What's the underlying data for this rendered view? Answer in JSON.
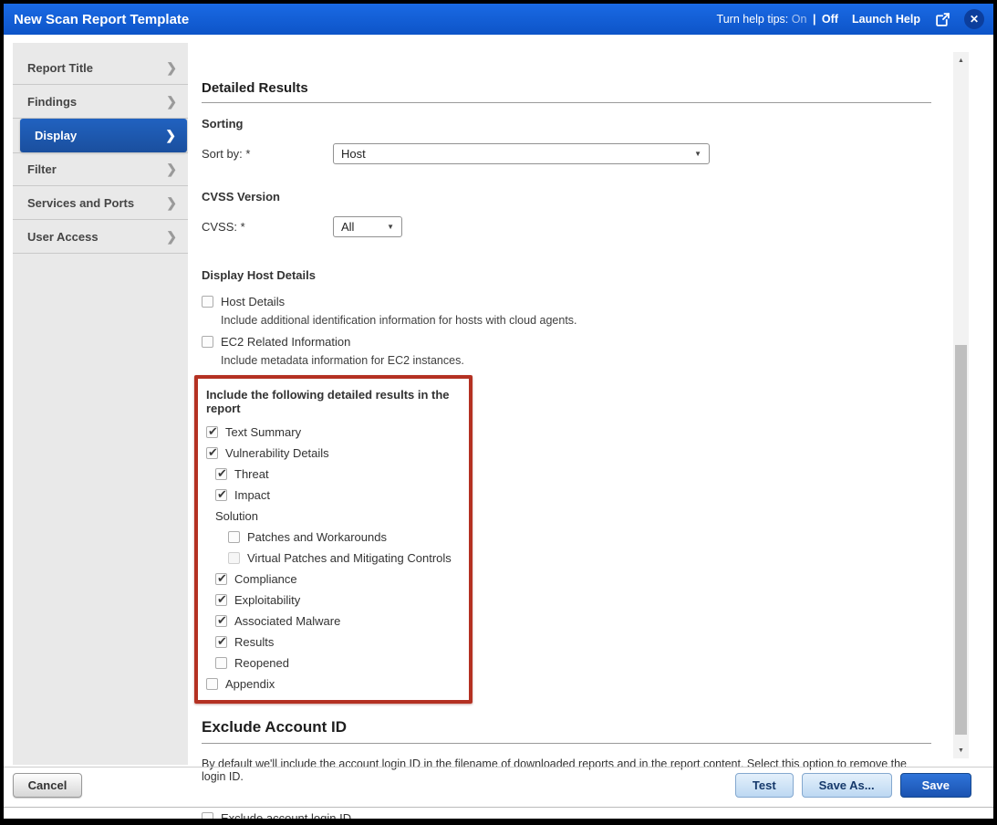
{
  "header": {
    "title": "New Scan Report Template",
    "help_tips_label": "Turn help tips:",
    "help_on": "On",
    "help_off": "Off",
    "launch_help": "Launch Help"
  },
  "icons": {
    "dropdown_arrow": "▼",
    "chevron": "❯",
    "close": "✕",
    "scroll_up": "▲",
    "scroll_down": "▼",
    "checkmark": "✔",
    "help_separator": "|"
  },
  "colors": {
    "header_blue": "#0d54c8",
    "active_item_blue": "#1d57ae",
    "annotation_red": "#b43122",
    "save_button_blue": "#1e5ec4"
  },
  "sidebar": {
    "items": [
      {
        "label": "Report Title",
        "active": false
      },
      {
        "label": "Findings",
        "active": false
      },
      {
        "label": "Display",
        "active": true
      },
      {
        "label": "Filter",
        "active": false
      },
      {
        "label": "Services and Ports",
        "active": false
      },
      {
        "label": "User Access",
        "active": false
      }
    ]
  },
  "main": {
    "detailed_results": {
      "title": "Detailed Results",
      "sorting_heading": "Sorting",
      "sort_by_label": "Sort by: *",
      "sort_by_value": "Host",
      "cvss_heading": "CVSS Version",
      "cvss_label": "CVSS: *",
      "cvss_value": "All"
    },
    "display_host": {
      "heading": "Display Host Details",
      "options": [
        {
          "label": "Host Details",
          "checkbox": true,
          "checked": false,
          "indent": 0,
          "desc": "Include additional identification information for hosts with cloud agents."
        },
        {
          "label": "EC2 Related Information",
          "checkbox": true,
          "checked": false,
          "indent": 0,
          "desc": "Include metadata information for EC2 instances."
        }
      ]
    },
    "include": {
      "heading": "Include the following detailed results in the report",
      "options": [
        {
          "label": "Text Summary",
          "checkbox": true,
          "checked": true,
          "indent": 0
        },
        {
          "label": "Vulnerability Details",
          "checkbox": true,
          "checked": true,
          "indent": 0
        },
        {
          "label": "Threat",
          "checkbox": true,
          "checked": true,
          "indent": 1
        },
        {
          "label": "Impact",
          "checkbox": true,
          "checked": true,
          "indent": 1
        },
        {
          "label": "Solution",
          "checkbox": false,
          "indent": 1
        },
        {
          "label": "Patches and Workarounds",
          "checkbox": true,
          "checked": false,
          "indent": 2
        },
        {
          "label": "Virtual Patches and Mitigating Controls",
          "checkbox": true,
          "checked": false,
          "disabled": true,
          "indent": 2
        },
        {
          "label": "Compliance",
          "checkbox": true,
          "checked": true,
          "indent": 1
        },
        {
          "label": "Exploitability",
          "checkbox": true,
          "checked": true,
          "indent": 1
        },
        {
          "label": "Associated Malware",
          "checkbox": true,
          "checked": true,
          "indent": 1
        },
        {
          "label": "Results",
          "checkbox": true,
          "checked": true,
          "indent": 1
        },
        {
          "label": "Reopened",
          "checkbox": true,
          "checked": false,
          "indent": 1
        },
        {
          "label": "Appendix",
          "checkbox": true,
          "checked": false,
          "indent": 0
        }
      ]
    },
    "exclude_account": {
      "title": "Exclude Account ID",
      "description": "By default we'll include the account login ID in the filename of downloaded reports and in the report content. Select this option to remove the login ID.",
      "checkbox_label": "Exclude account login ID",
      "checked": false
    }
  },
  "footer": {
    "cancel": "Cancel",
    "test": "Test",
    "save_as": "Save As...",
    "save": "Save"
  }
}
